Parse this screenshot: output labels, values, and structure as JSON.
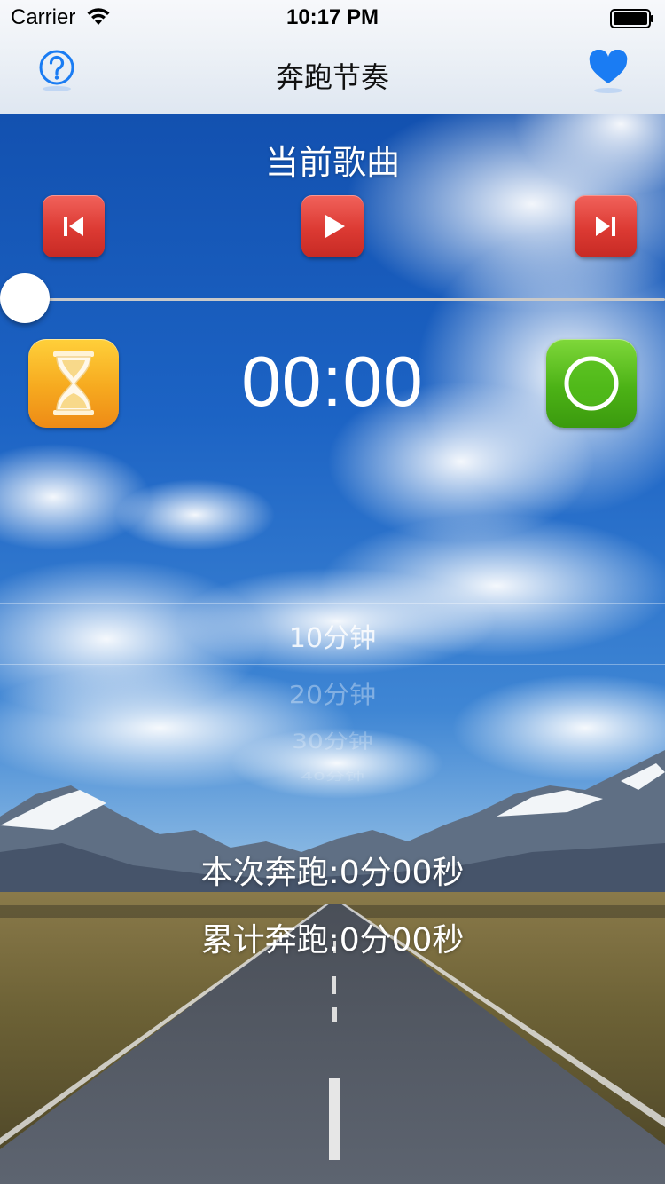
{
  "status_bar": {
    "carrier": "Carrier",
    "time": "10:17 PM",
    "icons": [
      "wifi-icon",
      "battery-icon"
    ]
  },
  "nav": {
    "title": "奔跑节奏",
    "left_icon": "help-icon",
    "right_icon": "heart-icon",
    "accent_color": "#1a7cf3"
  },
  "player": {
    "song_title": "当前歌曲",
    "controls": [
      "previous-icon",
      "play-icon",
      "next-icon"
    ],
    "progress": 0,
    "button_color": "#dc3a33"
  },
  "timer": {
    "display": "00:00",
    "timer_icon": "hourglass-icon",
    "start_icon": "record-icon"
  },
  "picker": {
    "options": [
      "10分钟",
      "20分钟",
      "30分钟",
      "40分钟"
    ],
    "selected_index": 0
  },
  "stats": {
    "current_label": "本次奔跑:",
    "current_value": "0分00秒",
    "total_label": "累计奔跑:",
    "total_value": "0分00秒"
  }
}
